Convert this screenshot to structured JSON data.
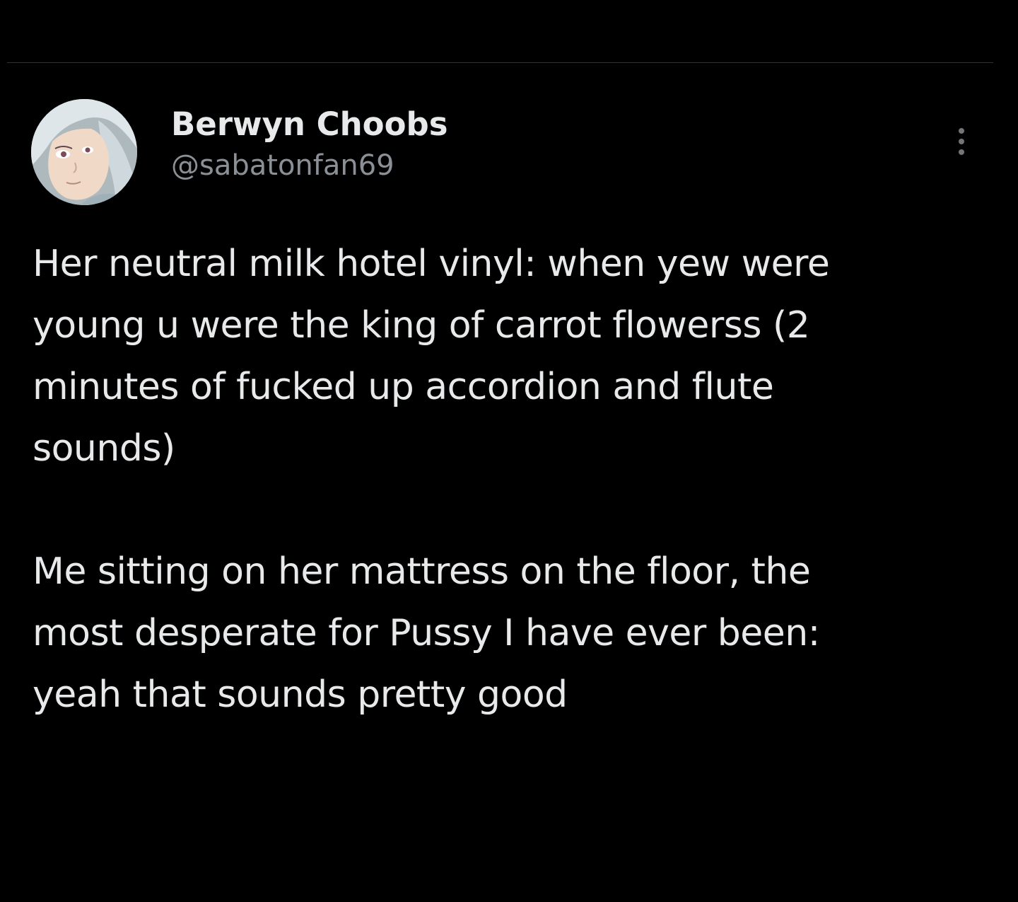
{
  "tweet": {
    "author": {
      "display_name": "Berwyn Choobs",
      "handle": "@sabatonfan69",
      "avatar_icon": "anime-character-avatar"
    },
    "more_icon": "more-options-icon",
    "paragraphs": [
      "Her neutral milk hotel vinyl: when yew were\nyoung u were the king of carrot flowerss (2\nminutes of fucked up accordion and flute\nsounds)",
      "Me sitting on her mattress on the floor, the\nmost desperate for Pussy I have ever been:\nyeah that sounds pretty good"
    ]
  },
  "colors": {
    "background": "#000000",
    "text_primary": "#e7e9ea",
    "text_secondary": "#8b9096",
    "divider": "#2f3336"
  }
}
